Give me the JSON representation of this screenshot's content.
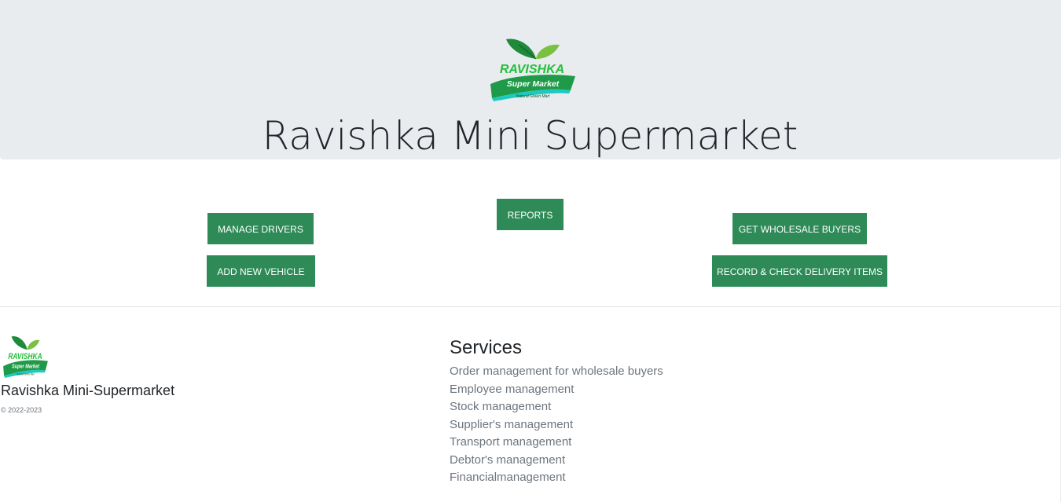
{
  "logo": {
    "brand_text": "RAVISHKA",
    "sub_text": "Super Market",
    "tagline": "Natural Green Mart"
  },
  "hero": {
    "title": "Ravishka Mini Supermarket"
  },
  "buttons": {
    "manage_drivers": "MANAGE DRIVERS",
    "add_new_vehicle": "ADD NEW VEHICLE",
    "reports": "REPORTS",
    "get_wholesale_buyers": "GET WHOLESALE BUYERS",
    "record_check_delivery": "RECORD & CHECK DELIVERY ITEMS"
  },
  "footer": {
    "company_name": "Ravishka Mini-Supermarket",
    "copyright": "© 2022-2023",
    "services_title": "Services",
    "services": [
      "Order management for wholesale buyers",
      "Employee management",
      "Stock management",
      "Supplier's management",
      "Transport management",
      "Debtor's management",
      "Financialmanagement"
    ]
  },
  "colors": {
    "button_bg": "#2e8b57",
    "hero_bg": "#e9ecef",
    "logo_green": "#22b14c",
    "logo_dark_green": "#1a7a3a"
  }
}
